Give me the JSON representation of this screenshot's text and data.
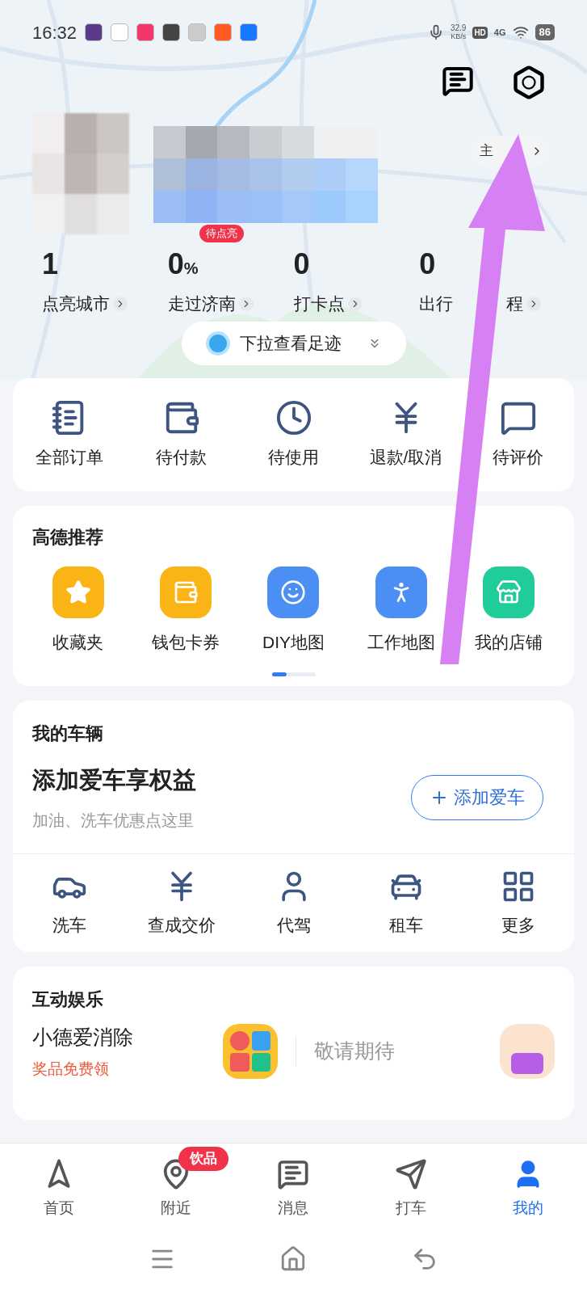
{
  "status_bar": {
    "time": "16:32",
    "net_speed": "32.9",
    "net_unit": "KB/s",
    "hd": "HD",
    "network": "4G",
    "battery": "86"
  },
  "profile": {
    "home_button": "主",
    "badge": "待点亮"
  },
  "stats": [
    {
      "value": "1",
      "label": "点亮城市"
    },
    {
      "value": "0",
      "unit": "%",
      "label": "走过济南"
    },
    {
      "value": "0",
      "label": "打卡点"
    },
    {
      "value": "0",
      "label": "出行",
      "label_tail": "程"
    }
  ],
  "pull_hint": "下拉查看足迹",
  "orders": [
    "全部订单",
    "待付款",
    "待使用",
    "退款/取消",
    "待评价"
  ],
  "recommend": {
    "title": "高德推荐",
    "items": [
      {
        "label": "收藏夹",
        "color": "#fbb416"
      },
      {
        "label": "钱包卡券",
        "color": "#fbb416"
      },
      {
        "label": "DIY地图",
        "color": "#4b8ff5"
      },
      {
        "label": "工作地图",
        "color": "#4b8ff5"
      },
      {
        "label": "我的店铺",
        "color": "#1fcc9a"
      }
    ],
    "pages": [
      {
        "selected": true
      },
      {
        "selected": false
      }
    ]
  },
  "vehicle": {
    "title": "我的车辆",
    "headline": "添加爱车享权益",
    "subtitle": "加油、洗车优惠点这里",
    "add_button": "添加爱车",
    "services": [
      "洗车",
      "查成交价",
      "代驾",
      "租车",
      "更多"
    ]
  },
  "entertainment": {
    "title": "互动娱乐",
    "game_name": "小德爱消除",
    "game_promo": "奖品免费领",
    "coming": "敬请期待"
  },
  "tabs": [
    {
      "label": "首页",
      "selected": false
    },
    {
      "label": "附近",
      "selected": false,
      "badge": "饮品"
    },
    {
      "label": "消息",
      "selected": false
    },
    {
      "label": "打车",
      "selected": false
    },
    {
      "label": "我的",
      "selected": true
    }
  ]
}
